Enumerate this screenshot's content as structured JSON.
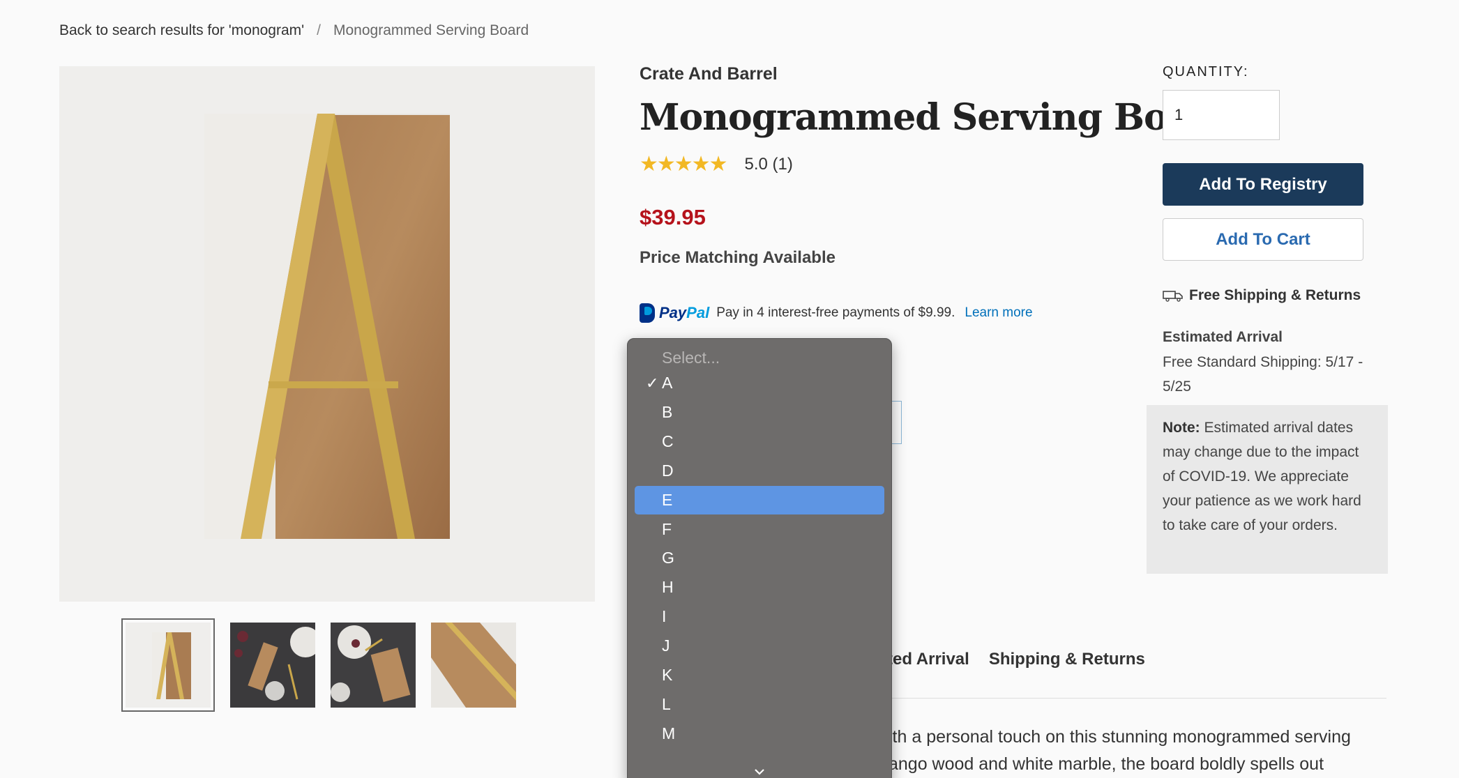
{
  "breadcrumb": {
    "back": "Back to search results for 'monogram'",
    "separator": "/",
    "current": "Monogrammed Serving Board"
  },
  "product": {
    "brand": "Crate And Barrel",
    "title": "Monogrammed Serving Board",
    "stars": "★★★★★",
    "rating": "5.0 (1)",
    "price": "$39.95",
    "price_match": "Price Matching Available"
  },
  "paypal": {
    "brand_pay": "Pay",
    "brand_pal": "Pal",
    "text": "Pay in 4 interest-free payments of $9.99.",
    "learn_more": "Learn more"
  },
  "dropdown": {
    "placeholder": "Select...",
    "checkmark": "✓",
    "items": [
      "A",
      "B",
      "C",
      "D",
      "E",
      "F",
      "G",
      "H",
      "I",
      "J",
      "K",
      "L",
      "M"
    ],
    "selected": "A",
    "highlighted": "E"
  },
  "tabs": {
    "partial": "ted Arrival",
    "shipping": "Shipping & Returns"
  },
  "description": {
    "line1": "ith a personal touch on this stunning monogrammed serving",
    "line2": "ango wood and white marble, the board boldly spells out"
  },
  "purchase": {
    "quantity_label": "QUANTITY:",
    "quantity_value": "1",
    "add_registry": "Add To Registry",
    "add_cart": "Add To Cart",
    "free_shipping": "Free Shipping & Returns",
    "arrival_title": "Estimated Arrival",
    "arrival_text": "Free Standard Shipping: 5/17 - 5/25",
    "note_label": "Note:",
    "note_text": " Estimated arrival dates may change due to the impact of COVID-19. We appreciate your patience as we work hard to take care of your orders."
  },
  "colors": {
    "price": "#b5121b",
    "registry_button": "#1b3a5a",
    "link": "#0070ba",
    "dropdown_highlight": "#5e95e3"
  }
}
